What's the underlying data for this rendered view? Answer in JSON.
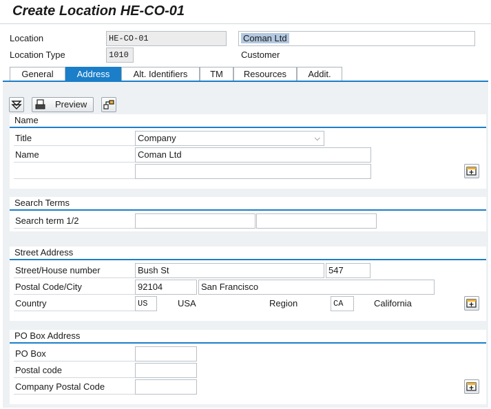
{
  "page_title": "Create Location HE-CO-01",
  "header": {
    "location_label": "Location",
    "location_value": "HE-CO-01",
    "location_desc": "Coman Ltd",
    "type_label": "Location Type",
    "type_value": "1010",
    "type_desc": "Customer"
  },
  "tabs": [
    {
      "label": "General"
    },
    {
      "label": "Address",
      "active": true
    },
    {
      "label": "Alt. Identifiers"
    },
    {
      "label": "TM"
    },
    {
      "label": "Resources"
    },
    {
      "label": "Addit."
    }
  ],
  "toolbar": {
    "preview_label": "Preview"
  },
  "name_section": {
    "title": "Name",
    "title_label": "Title",
    "title_value": "Company",
    "name_label": "Name",
    "name_value": "Coman Ltd",
    "name2_value": ""
  },
  "search_section": {
    "title": "Search Terms",
    "term_label": "Search term 1/2",
    "term1_value": "",
    "term2_value": ""
  },
  "street_section": {
    "title": "Street Address",
    "street_label": "Street/House number",
    "street_value": "Bush St",
    "house_value": "547",
    "postal_label": "Postal Code/City",
    "postal_value": "92104",
    "city_value": "San Francisco",
    "country_label": "Country",
    "country_code": "US",
    "country_name": "USA",
    "region_label": "Region",
    "region_code": "CA",
    "region_name": "California"
  },
  "pobox_section": {
    "title": "PO Box Address",
    "pobox_label": "PO Box",
    "pobox_value": "",
    "postal_label": "Postal code",
    "postal_value": "",
    "company_postal_label": "Company Postal Code",
    "company_postal_value": ""
  },
  "colors": {
    "accent": "#1a7ec8",
    "background": "#eef1f3"
  }
}
